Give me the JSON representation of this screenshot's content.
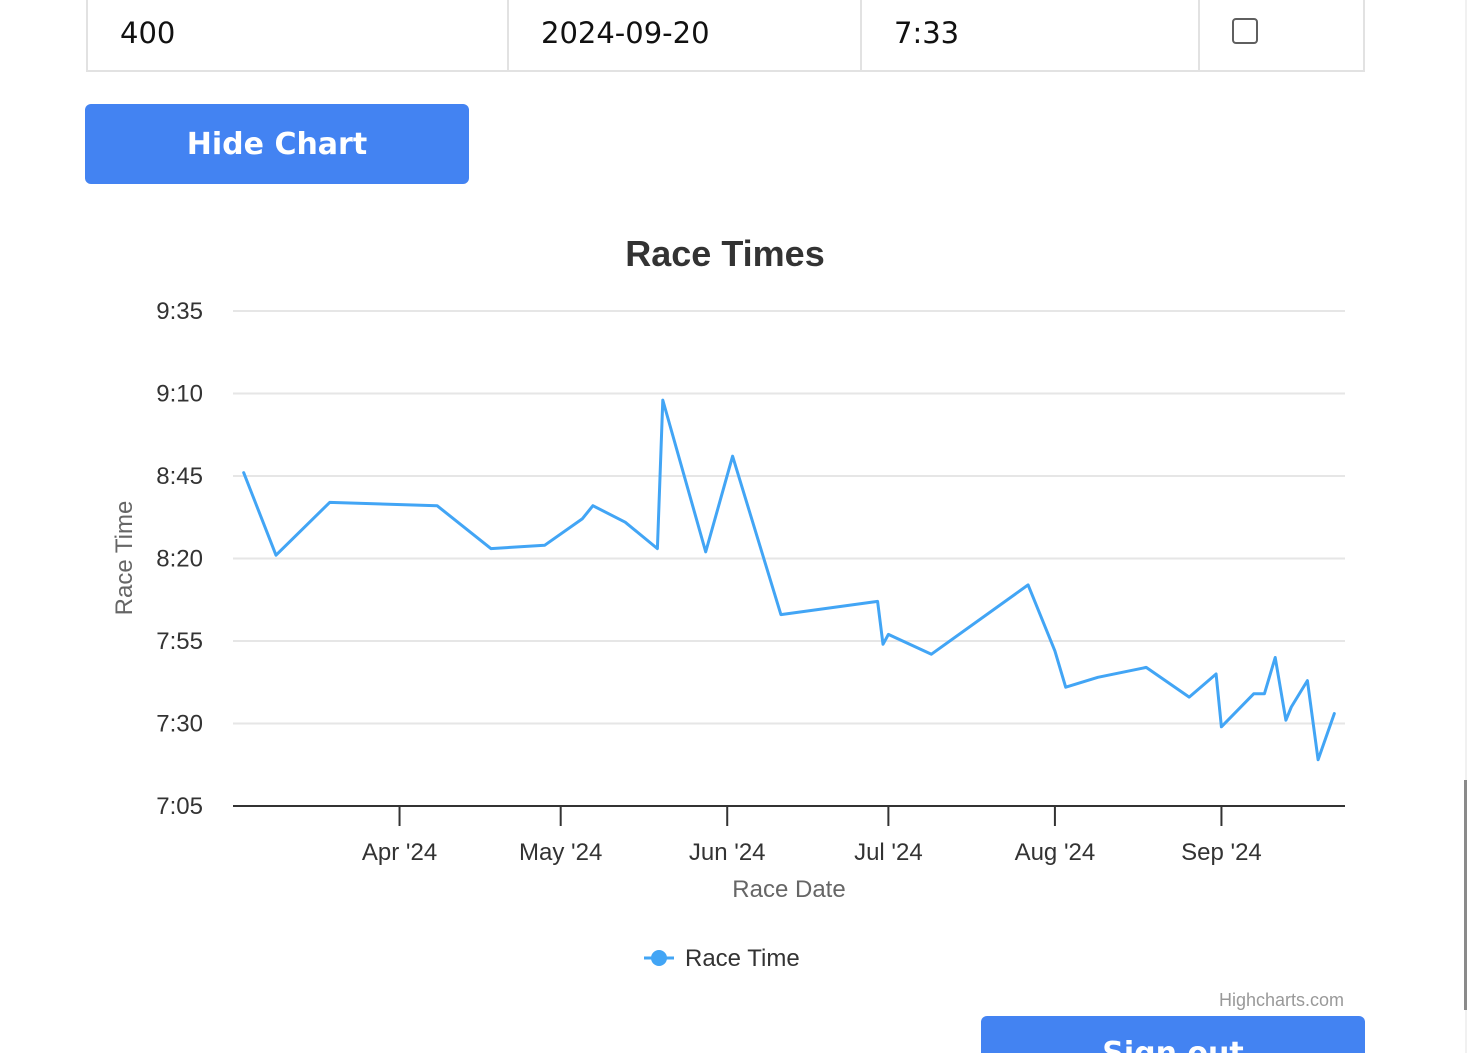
{
  "table": {
    "row": {
      "distance": "400",
      "date": "2024-09-20",
      "time": "7:33",
      "checked": false
    }
  },
  "buttons": {
    "hide_chart": "Hide Chart",
    "sign_out": "Sign out"
  },
  "chart_data": {
    "type": "line",
    "title": "Race Times",
    "xlabel": "Race Date",
    "ylabel": "Race Time",
    "ylim": [
      "7:05",
      "9:35"
    ],
    "yticks": [
      "7:05",
      "7:30",
      "7:55",
      "8:20",
      "8:45",
      "9:10",
      "9:35"
    ],
    "xticks": [
      "Apr '24",
      "May '24",
      "Jun '24",
      "Jul '24",
      "Aug '24",
      "Sep '24"
    ],
    "grid": true,
    "legend": "bottom-center",
    "credits": "Highcharts.com",
    "color": "#42a5f5",
    "series": [
      {
        "name": "Race Time",
        "points": [
          [
            "2024-03-03",
            "8:46"
          ],
          [
            "2024-03-09",
            "8:21"
          ],
          [
            "2024-03-19",
            "8:37"
          ],
          [
            "2024-04-08",
            "8:36"
          ],
          [
            "2024-04-18",
            "8:23"
          ],
          [
            "2024-04-28",
            "8:24"
          ],
          [
            "2024-05-05",
            "8:32"
          ],
          [
            "2024-05-07",
            "8:36"
          ],
          [
            "2024-05-13",
            "8:31"
          ],
          [
            "2024-05-19",
            "8:23"
          ],
          [
            "2024-05-20",
            "9:08"
          ],
          [
            "2024-05-28",
            "8:22"
          ],
          [
            "2024-06-02",
            "8:51"
          ],
          [
            "2024-06-11",
            "8:03"
          ],
          [
            "2024-06-29",
            "8:07"
          ],
          [
            "2024-06-30",
            "7:54"
          ],
          [
            "2024-07-01",
            "7:57"
          ],
          [
            "2024-07-09",
            "7:51"
          ],
          [
            "2024-07-27",
            "8:12"
          ],
          [
            "2024-08-01",
            "7:52"
          ],
          [
            "2024-08-03",
            "7:41"
          ],
          [
            "2024-08-09",
            "7:44"
          ],
          [
            "2024-08-18",
            "7:47"
          ],
          [
            "2024-08-26",
            "7:38"
          ],
          [
            "2024-08-31",
            "7:45"
          ],
          [
            "2024-09-01",
            "7:29"
          ],
          [
            "2024-09-07",
            "7:39"
          ],
          [
            "2024-09-09",
            "7:39"
          ],
          [
            "2024-09-11",
            "7:50"
          ],
          [
            "2024-09-13",
            "7:31"
          ],
          [
            "2024-09-14",
            "7:35"
          ],
          [
            "2024-09-17",
            "7:43"
          ],
          [
            "2024-09-19",
            "7:19"
          ],
          [
            "2024-09-22",
            "7:33"
          ]
        ]
      }
    ]
  }
}
